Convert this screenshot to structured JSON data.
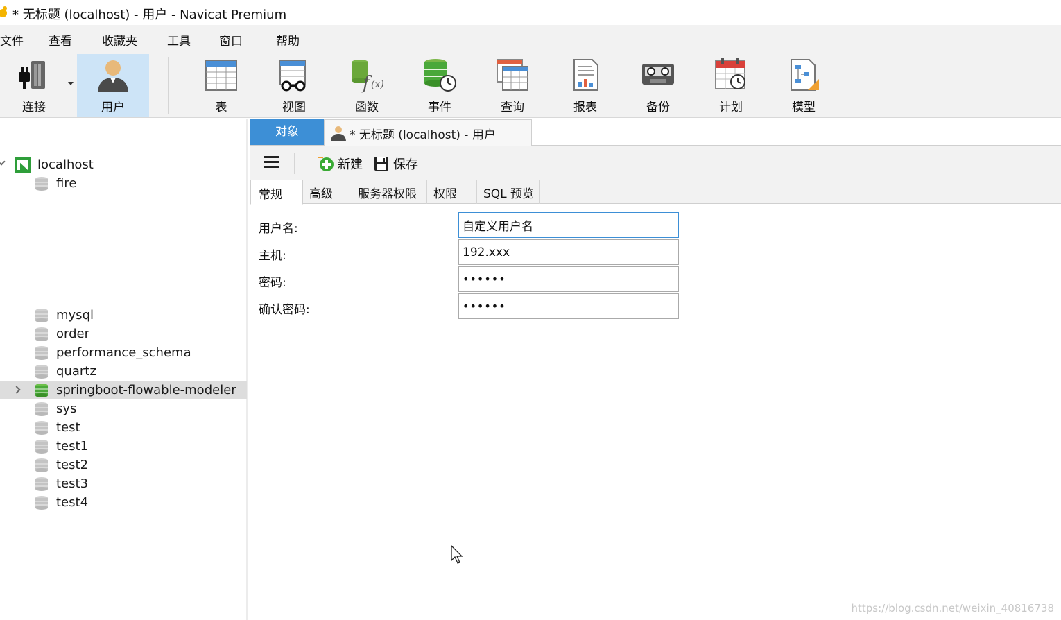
{
  "window": {
    "title": "* 无标题 (localhost) - 用户 - Navicat Premium"
  },
  "menu": [
    "文件",
    "查看",
    "收藏夹",
    "工具",
    "窗口",
    "帮助"
  ],
  "toolbar": {
    "buttons": [
      {
        "label": "连接",
        "icon": "connect-plug-icon"
      },
      {
        "label": "用户",
        "icon": "user-icon",
        "active": true
      },
      {
        "label": "表",
        "icon": "table-icon"
      },
      {
        "label": "视图",
        "icon": "view-glasses-icon"
      },
      {
        "label": "函数",
        "icon": "function-fx-icon"
      },
      {
        "label": "事件",
        "icon": "event-clock-icon"
      },
      {
        "label": "查询",
        "icon": "query-icon"
      },
      {
        "label": "报表",
        "icon": "report-icon"
      },
      {
        "label": "备份",
        "icon": "backup-tape-icon"
      },
      {
        "label": "计划",
        "icon": "schedule-calendar-icon"
      },
      {
        "label": "模型",
        "icon": "model-icon"
      }
    ]
  },
  "sidebar": {
    "connection": "localhost",
    "databases": [
      "fire",
      "mysql",
      "order",
      "performance_schema",
      "quartz",
      "springboot-flowable-modeler",
      "sys",
      "test",
      "test1",
      "test2",
      "test3",
      "test4"
    ],
    "selected": "springboot-flowable-modeler"
  },
  "tabs": {
    "objects": "对象",
    "document": "* 无标题 (localhost) - 用户"
  },
  "subtoolbar": {
    "new_label": "新建",
    "save_label": "保存"
  },
  "panel_tabs": [
    "常规",
    "高级",
    "服务器权限",
    "权限",
    "SQL 预览"
  ],
  "form": {
    "username_label": "用户名:",
    "username_value": "自定义用户名",
    "host_label": "主机:",
    "host_value": "192.xxx",
    "password_label": "密码:",
    "password_value": "••••••",
    "confirm_label": "确认密码:",
    "confirm_value": "••••••"
  },
  "watermark": "https://blog.csdn.net/weixin_40816738",
  "colors": {
    "accent": "#3d8fd6",
    "active_toolbar": "#cde4f7",
    "db_green": "#4aa83a"
  }
}
